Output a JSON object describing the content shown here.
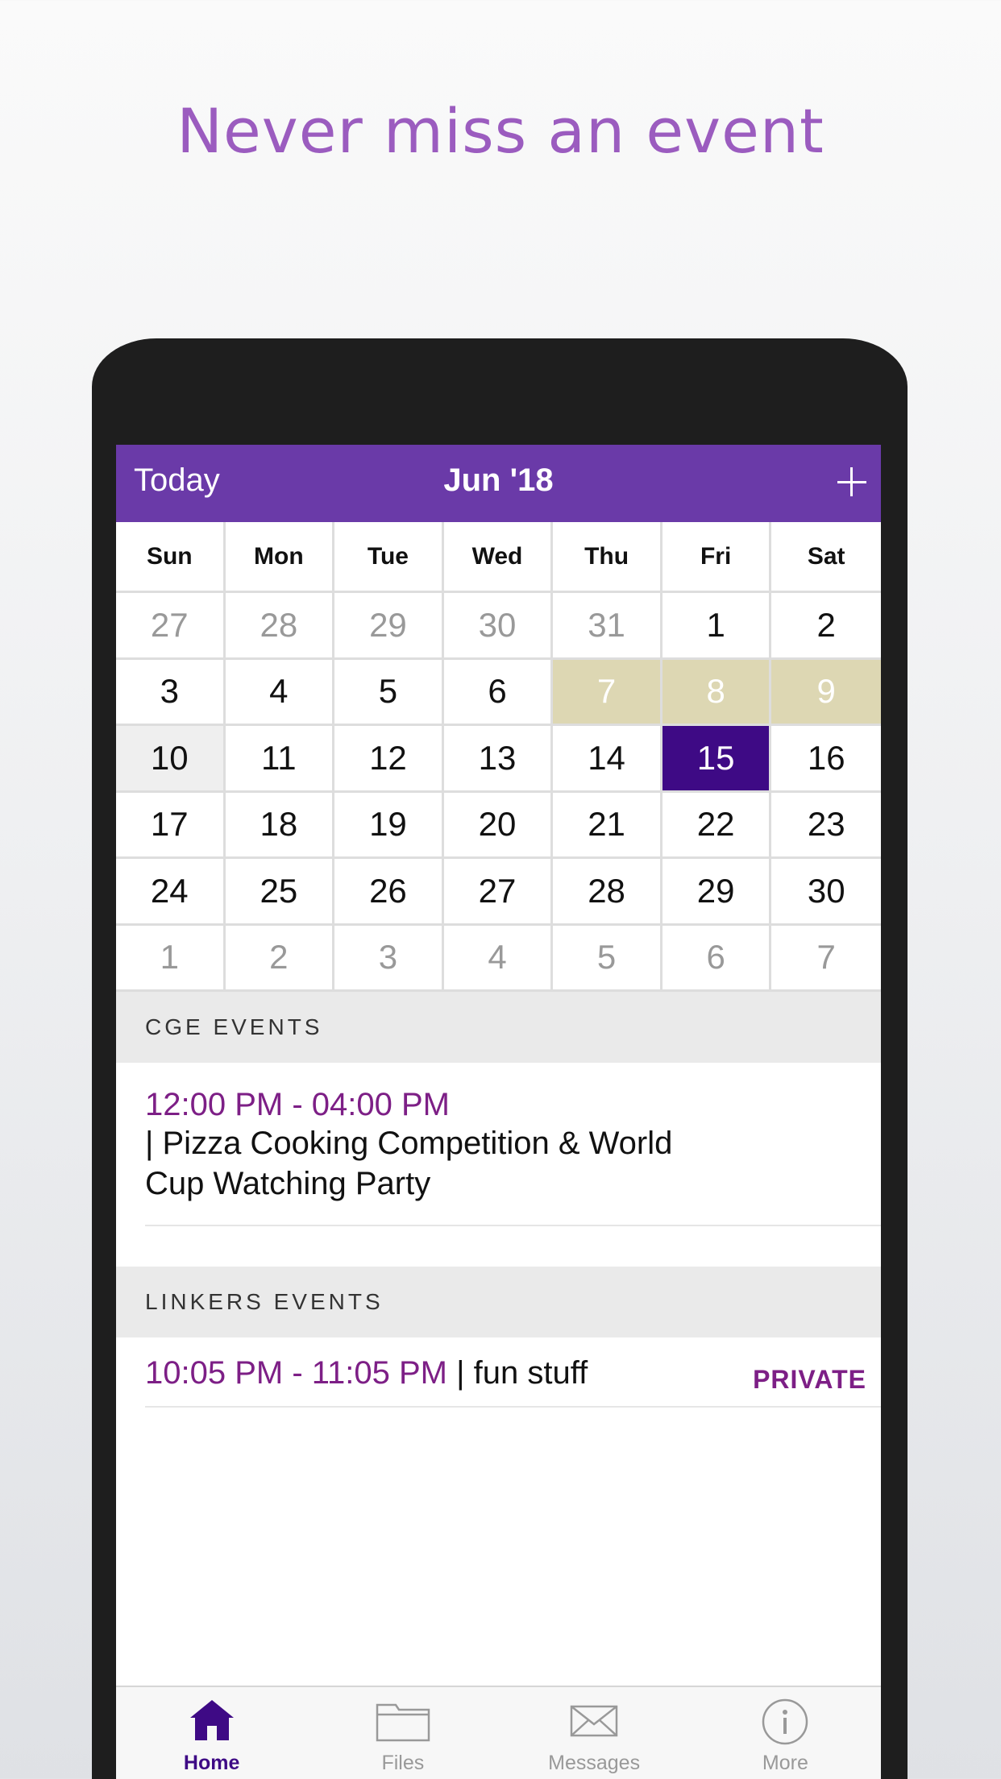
{
  "headline": "Never miss an event",
  "nav": {
    "left": "Today",
    "title": "Jun '18",
    "add_icon": "plus-icon"
  },
  "calendar": {
    "weekdays": [
      "Sun",
      "Mon",
      "Tue",
      "Wed",
      "Thu",
      "Fri",
      "Sat"
    ],
    "weeks": [
      [
        "27",
        "28",
        "29",
        "30",
        "31",
        "1",
        "2"
      ],
      [
        "3",
        "4",
        "5",
        "6",
        "7",
        "8",
        "9"
      ],
      [
        "10",
        "11",
        "12",
        "13",
        "14",
        "15",
        "16"
      ],
      [
        "17",
        "18",
        "19",
        "20",
        "21",
        "22",
        "23"
      ],
      [
        "24",
        "25",
        "26",
        "27",
        "28",
        "29",
        "30"
      ],
      [
        "1",
        "2",
        "3",
        "4",
        "5",
        "6",
        "7"
      ]
    ],
    "selected_day": "15",
    "today_day": "10",
    "highlight_color": "#ddd7b3",
    "selected_color": "#3e0a85",
    "accent": "#6a3aa8"
  },
  "sections": [
    {
      "title": "CGE EVENTS",
      "events": [
        {
          "time": "12:00 PM - 04:00 PM",
          "name": "| Pizza Cooking Competition & World",
          "name_line2": "Cup Watching Party"
        }
      ]
    },
    {
      "title": "LINKERS EVENTS",
      "events": [
        {
          "time": "10:05 PM - 11:05 PM",
          "name": " | fun stuff",
          "badge": "PRIVATE"
        }
      ]
    }
  ],
  "tabbar": {
    "items": [
      {
        "label": "Home",
        "icon": "home-icon",
        "active": true
      },
      {
        "label": "Files",
        "icon": "folder-icon",
        "active": false
      },
      {
        "label": "Messages",
        "icon": "envelope-icon",
        "active": false
      },
      {
        "label": "More",
        "icon": "info-icon",
        "active": false
      }
    ]
  }
}
